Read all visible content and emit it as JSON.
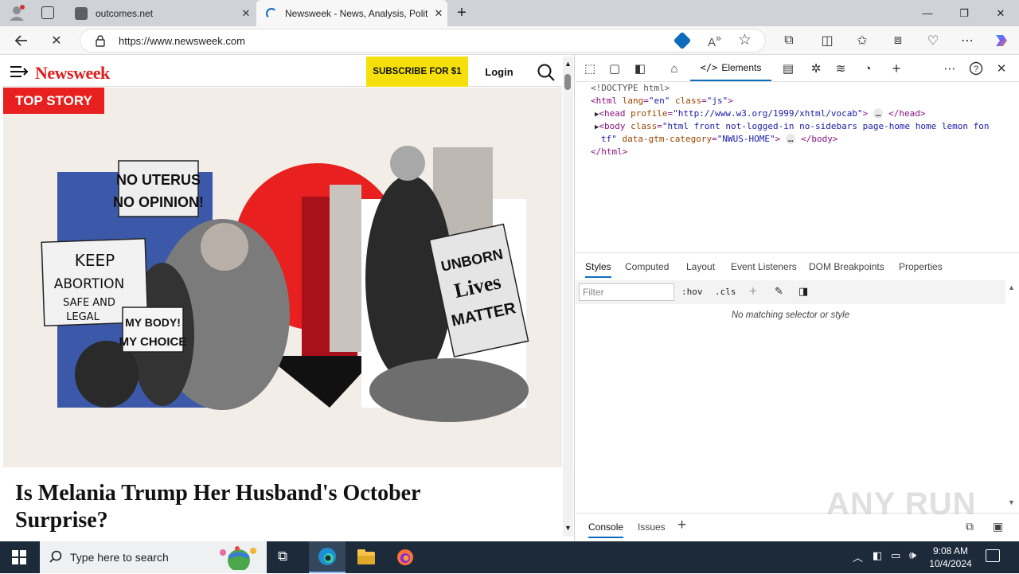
{
  "browser": {
    "tabs": [
      {
        "title": "outcomes.net",
        "active": false
      },
      {
        "title": "Newsweek - News, Analysis, Polit",
        "active": true
      }
    ],
    "url": "https://www.newsweek.com"
  },
  "site": {
    "logo": "Newsweek",
    "subscribe_label": "SUBSCRIBE FOR $1",
    "login_label": "Login",
    "badge": "TOP STORY",
    "headline": "Is Melania Trump Her Husband's October Surprise?",
    "signs": {
      "sign1_line1": "NO UTERUS",
      "sign1_line2": "NO OPINION!",
      "sign2_line1": "KEEP",
      "sign2_line2": "ABORTION",
      "sign2_line3": "SAFE AND",
      "sign2_line4": "LEGAL",
      "sign3_line1": "MY BODY!",
      "sign3_line2": "MY CHOICE",
      "sign4_line1": "UNBORN",
      "sign4_line2": "Lives",
      "sign4_line3": "MATTER"
    }
  },
  "devtools": {
    "elements_tab": "Elements",
    "dom": {
      "doctype": "<!DOCTYPE html>",
      "html_open_tag": "html",
      "html_lang_attr": "lang",
      "html_lang_val": "\"en\"",
      "html_class_attr": "class",
      "html_class_val": "\"js\"",
      "head_tag": "head",
      "head_attr": "profile",
      "head_val": "\"http://www.w3.org/1999/xhtml/vocab\"",
      "head_close": "</head>",
      "body_tag": "body",
      "body_attr": "class",
      "body_val_1": "\"html front not-logged-in no-sidebars page-home home lemon fon",
      "body_val_2": "tf\"",
      "body_attr2": "data-gtm-category",
      "body_val2": "\"NWUS-HOME\"",
      "body_close": "</body>",
      "html_close": "</html>",
      "ellipsis": "…"
    },
    "styles_tabs": [
      "Styles",
      "Computed",
      "Layout",
      "Event Listeners",
      "DOM Breakpoints",
      "Properties"
    ],
    "filter_placeholder": "Filter",
    "hov": ":hov",
    "cls": ".cls",
    "no_match": "No matching selector or style",
    "drawer_tabs": [
      "Console",
      "Issues"
    ]
  },
  "taskbar": {
    "search_placeholder": "Type here to search",
    "time": "9:08 AM",
    "date": "10/4/2024"
  },
  "watermark": "ANY RUN",
  "colors": {
    "accent": "#e8201f",
    "subscribe": "#f5e00b",
    "edge_blue": "#0f6cbd"
  }
}
